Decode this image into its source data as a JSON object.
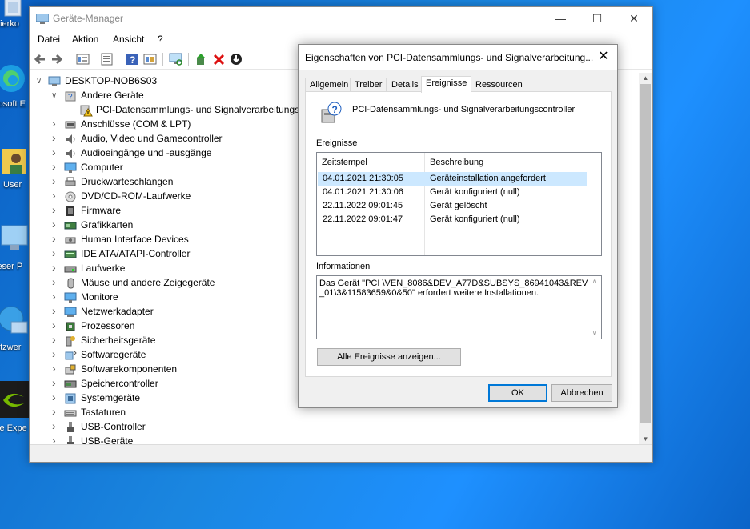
{
  "desktop": {
    "icons": [
      {
        "name": "papierkorb",
        "caption": "pierko"
      },
      {
        "name": "microsoft-edge",
        "caption": "rosoft E"
      },
      {
        "name": "user",
        "caption": "User"
      },
      {
        "name": "dieser-pc",
        "caption": "ieser P"
      },
      {
        "name": "netzwerk",
        "caption": "etzwer"
      },
      {
        "name": "geforce-experience",
        "caption": "ce Expe"
      }
    ]
  },
  "device_manager": {
    "title": "Geräte-Manager",
    "controls": {
      "minimize": "—",
      "maximize": "☐",
      "close": "✕"
    },
    "menu": [
      "Datei",
      "Aktion",
      "Ansicht",
      "?"
    ],
    "toolbar_icons": [
      "back-icon",
      "forward-icon",
      "properties-grid-icon",
      "properties-icon",
      "help-icon",
      "view-icon",
      "scan-hardware-icon",
      "update-driver-icon",
      "uninstall-icon",
      "download-icon"
    ],
    "tree": {
      "root": "DESKTOP-NOB6S03",
      "other_devices": {
        "label": "Andere Geräte",
        "children": [
          "PCI-Datensammlungs- und Signalverarbeitungscontroller"
        ]
      },
      "categories": [
        {
          "label": "Anschlüsse (COM & LPT)",
          "icon": "port-icon"
        },
        {
          "label": "Audio, Video und Gamecontroller",
          "icon": "speaker-icon"
        },
        {
          "label": "Audioeingänge und -ausgänge",
          "icon": "speaker-icon"
        },
        {
          "label": "Computer",
          "icon": "monitor-icon"
        },
        {
          "label": "Druckwarteschlangen",
          "icon": "printer-icon"
        },
        {
          "label": "DVD/CD-ROM-Laufwerke",
          "icon": "disc-icon"
        },
        {
          "label": "Firmware",
          "icon": "chip-icon"
        },
        {
          "label": "Grafikkarten",
          "icon": "graphics-card-icon"
        },
        {
          "label": "Human Interface Devices",
          "icon": "hid-icon"
        },
        {
          "label": "IDE ATA/ATAPI-Controller",
          "icon": "controller-icon"
        },
        {
          "label": "Laufwerke",
          "icon": "drive-icon"
        },
        {
          "label": "Mäuse und andere Zeigegeräte",
          "icon": "mouse-icon"
        },
        {
          "label": "Monitore",
          "icon": "monitor-icon"
        },
        {
          "label": "Netzwerkadapter",
          "icon": "network-icon"
        },
        {
          "label": "Prozessoren",
          "icon": "cpu-icon"
        },
        {
          "label": "Sicherheitsgeräte",
          "icon": "key-icon"
        },
        {
          "label": "Softwaregeräte",
          "icon": "software-icon"
        },
        {
          "label": "Softwarekomponenten",
          "icon": "component-icon"
        },
        {
          "label": "Speichercontroller",
          "icon": "storage-icon"
        },
        {
          "label": "Systemgeräte",
          "icon": "system-icon"
        },
        {
          "label": "Tastaturen",
          "icon": "keyboard-icon"
        },
        {
          "label": "USB-Controller",
          "icon": "usb-icon"
        },
        {
          "label": "USB-Geräte",
          "icon": "usb-icon"
        }
      ]
    }
  },
  "properties_dialog": {
    "title": "Eigenschaften von PCI-Datensammlungs- und Signalverarbeitung...",
    "close": "✕",
    "tabs": [
      "Allgemein",
      "Treiber",
      "Details",
      "Ereignisse",
      "Ressourcen"
    ],
    "active_tab": "Ereignisse",
    "device_name": "PCI-Datensammlungs- und Signalverarbeitungscontroller",
    "events_label": "Ereignisse",
    "columns": [
      "Zeitstempel",
      "Beschreibung"
    ],
    "events": [
      {
        "timestamp": "04.01.2021 21:30:05",
        "description": "Geräteinstallation angefordert",
        "selected": true
      },
      {
        "timestamp": "04.01.2021 21:30:06",
        "description": "Gerät konfiguriert (null)",
        "selected": false
      },
      {
        "timestamp": "22.11.2022 09:01:45",
        "description": "Gerät gelöscht",
        "selected": false
      },
      {
        "timestamp": "22.11.2022 09:01:47",
        "description": "Gerät konfiguriert (null)",
        "selected": false
      }
    ],
    "info_label": "Informationen",
    "info_text": "Das Gerät \"PCI \\VEN_8086&DEV_A77D&SUBSYS_86941043&REV_01\\3&11583659&0&50\" erfordert weitere Installationen.",
    "show_all_button": "Alle Ereignisse anzeigen...",
    "ok_button": "OK",
    "cancel_button": "Abbrechen"
  },
  "colors": {
    "selection": "#cce8ff",
    "accent": "#0078d7",
    "desktop": "#1a86e0"
  }
}
